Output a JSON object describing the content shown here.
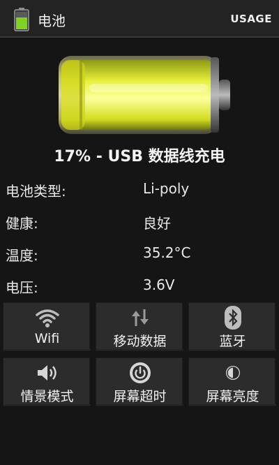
{
  "app": {
    "title": "电池",
    "usage_label": "USAGE"
  },
  "battery": {
    "level_percent": 17,
    "fill_color": "#e6f23a"
  },
  "status": {
    "text": "17% - USB 数据线充电"
  },
  "info": [
    {
      "label": "电池类型:",
      "value": "Li-poly"
    },
    {
      "label": "健康:",
      "value": "良好"
    },
    {
      "label": "温度:",
      "value": "35.2°C"
    },
    {
      "label": "电压:",
      "value": "3.6V"
    }
  ],
  "toggles": [
    {
      "label": "Wifi",
      "icon": "wifi-icon"
    },
    {
      "label": "移动数据",
      "icon": "mobile-data-icon"
    },
    {
      "label": "蓝牙",
      "icon": "bluetooth-icon"
    },
    {
      "label": "情景模式",
      "icon": "volume-icon"
    },
    {
      "label": "屏幕超时",
      "icon": "power-icon"
    },
    {
      "label": "屏幕亮度",
      "icon": "brightness-icon"
    }
  ]
}
